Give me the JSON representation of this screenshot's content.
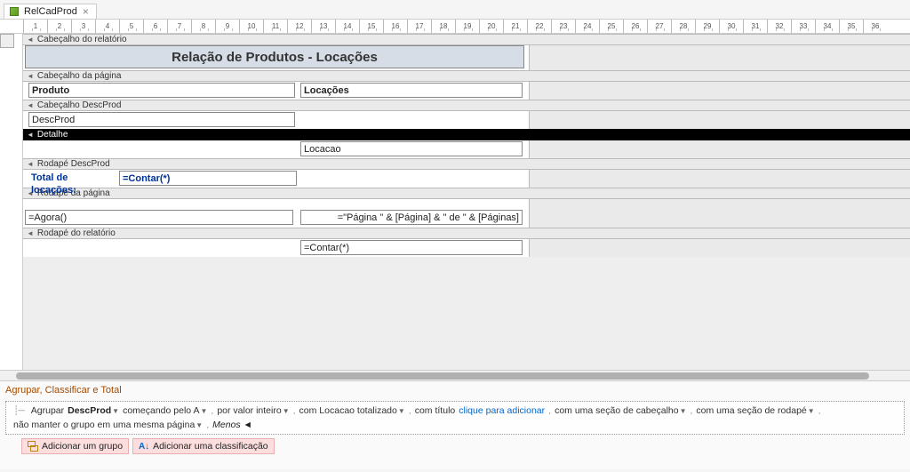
{
  "tab": {
    "title": "RelCadProd"
  },
  "ruler_marks": [
    "1",
    "2",
    "3",
    "4",
    "5",
    "6",
    "7",
    "8",
    "9",
    "10",
    "11",
    "12",
    "13",
    "14",
    "15",
    "16",
    "17",
    "18",
    "19",
    "20",
    "21",
    "22",
    "23",
    "24",
    "25",
    "26",
    "27",
    "28",
    "29",
    "30",
    "31",
    "32",
    "33",
    "34",
    "35",
    "36"
  ],
  "sections": {
    "report_header": "Cabeçalho do relatório",
    "page_header": "Cabeçalho da página",
    "group_header": "Cabeçalho DescProd",
    "detail": "Detalhe",
    "group_footer": "Rodapé DescProd",
    "page_footer": "Rodapé da página",
    "report_footer": "Rodapé do relatório"
  },
  "controls": {
    "title": "Relação de Produtos  - Locações",
    "col1": "Produto",
    "col2": "Locações",
    "group_field": "DescProd",
    "detail_field": "Locacao",
    "total_label": "Total de locações:",
    "total_expr": "=Contar(*)",
    "now_expr": "=Agora()",
    "page_expr": "=\"Página \" & [Página] & \" de \" & [Páginas]",
    "grand_total_expr": "=Contar(*)"
  },
  "gst": {
    "title": "Agrupar, Classificar e Total",
    "group_word": "Agrupar",
    "field": "DescProd",
    "start": "começando pelo A",
    "whole": "por valor inteiro",
    "totaled": "com Locacao totalizado",
    "with_title": "com título",
    "click_add": "clique para adicionar",
    "header_sec": "com uma seção de cabeçalho",
    "footer_sec": "com uma seção de rodapé",
    "keep": "não manter o grupo em uma mesma página",
    "less": "Menos",
    "add_group": "Adicionar um grupo",
    "add_sort": "Adicionar uma classificação"
  }
}
